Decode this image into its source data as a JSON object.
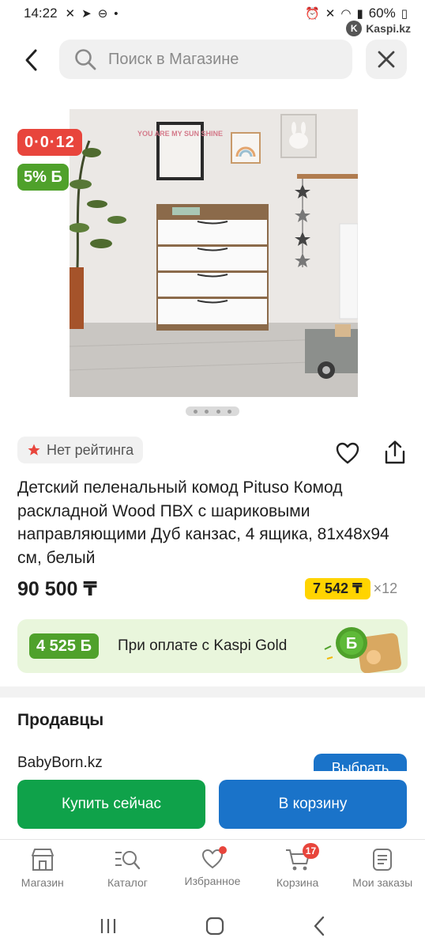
{
  "status_bar": {
    "time": "14:22",
    "battery": "60%",
    "watermark": "Kaspi.kz"
  },
  "search": {
    "placeholder": "Поиск в Магазине"
  },
  "product": {
    "timer_badge": "0·0·12",
    "bonus_badge": "5% Б",
    "rating_label": "Нет рейтинга",
    "title": "Детский пеленальный комод Pituso Комод раскладной Wood ПВХ с шариковыми направляющими Дуб канзас, 4 ящика, 81x48x94 см, белый",
    "price": "90 500 ₸",
    "installment_amount": "7 542 ₸",
    "installment_months": "×12",
    "gallery_pages": 4
  },
  "poster_text": "YOU ARE MY SUN SHINE",
  "kaspi_gold": {
    "bonus": "4 525 Б",
    "text": "При оплате с Kaspi Gold"
  },
  "sellers": {
    "title": "Продавцы",
    "first_seller": "BabyBorn.kz",
    "select_label": "Выбрать"
  },
  "actions": {
    "buy_now": "Купить сейчас",
    "add_to_cart": "В корзину"
  },
  "bottom_nav": {
    "shop": "Магазин",
    "catalog": "Каталог",
    "favorites": "Избранное",
    "cart": "Корзина",
    "cart_count": "17",
    "orders": "Мои заказы"
  },
  "colors": {
    "red": "#e8453c",
    "green": "#4fa12b",
    "buy_green": "#0fa24a",
    "blue": "#1a73c9",
    "yellow": "#ffd400"
  }
}
